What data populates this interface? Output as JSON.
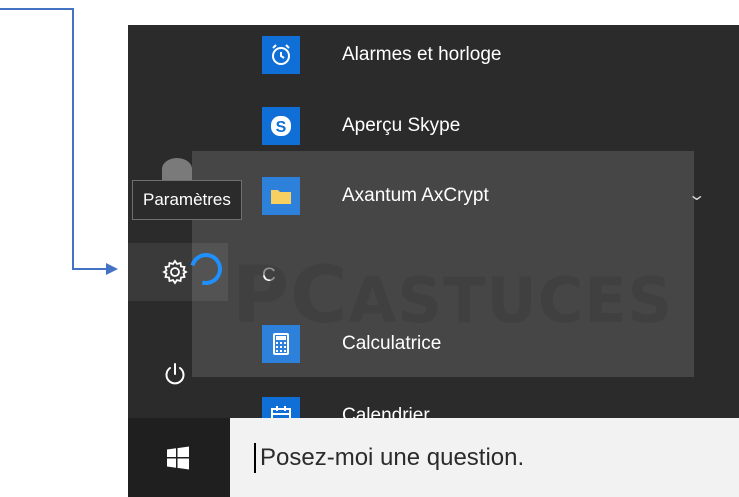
{
  "tooltip": {
    "label": "Paramètres"
  },
  "apps": [
    {
      "label": "Alarmes et horloge",
      "icon": "alarm-clock-icon"
    },
    {
      "label": "Aperçu Skype",
      "icon": "skype-icon"
    },
    {
      "label": "Axantum AxCrypt",
      "icon": "folder-icon"
    },
    {
      "group_letter": "C"
    },
    {
      "label": "Calculatrice",
      "icon": "calculator-icon"
    },
    {
      "label": "Calendrier",
      "icon": "calendar-icon"
    }
  ],
  "watermark": {
    "text_a": "PC",
    "text_b": "ASTUCES"
  },
  "search": {
    "placeholder": "Posez-moi une question."
  },
  "colors": {
    "accent": "#0f6fd6",
    "menu_bg": "#2b2b2b",
    "arrow": "#4472c4",
    "highlight": "#1e90ff"
  }
}
